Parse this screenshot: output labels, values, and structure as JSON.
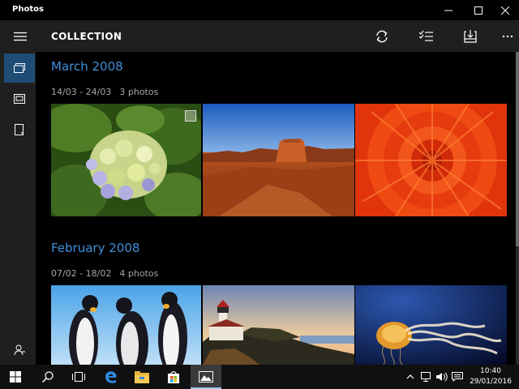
{
  "window": {
    "title": "Photos"
  },
  "header": {
    "title": "COLLECTION"
  },
  "groups": [
    {
      "month": "March 2008",
      "range": "14/03 - 24/03",
      "count": "3 photos"
    },
    {
      "month": "February 2008",
      "range": "07/02 - 18/02",
      "count": "4 photos"
    }
  ],
  "photos": [
    {
      "subject": "hydrangea",
      "selected": true
    },
    {
      "subject": "desert"
    },
    {
      "subject": "red-flower"
    },
    {
      "subject": "penguins"
    },
    {
      "subject": "lighthouse"
    },
    {
      "subject": "jellyfish"
    }
  ],
  "clock": {
    "time": "10:40",
    "date": "29/01/2016"
  },
  "colors": {
    "accent": "#3f8fd8",
    "sidebar_active": "#1e4c74",
    "header_bg": "#1f1f1f",
    "background": "#000000"
  },
  "icons": {
    "header": [
      "refresh-icon",
      "select-icon",
      "import-icon",
      "more-icon"
    ],
    "sidebar": [
      "collection-icon",
      "albums-icon",
      "folders-icon",
      "account-icon"
    ],
    "taskbar": [
      "start-icon",
      "search-icon",
      "task-view-icon",
      "edge-icon",
      "file-explorer-icon",
      "store-icon",
      "photos-app-icon"
    ],
    "tray": [
      "chevron-up-icon",
      "network-icon",
      "volume-icon",
      "action-center-icon"
    ]
  }
}
